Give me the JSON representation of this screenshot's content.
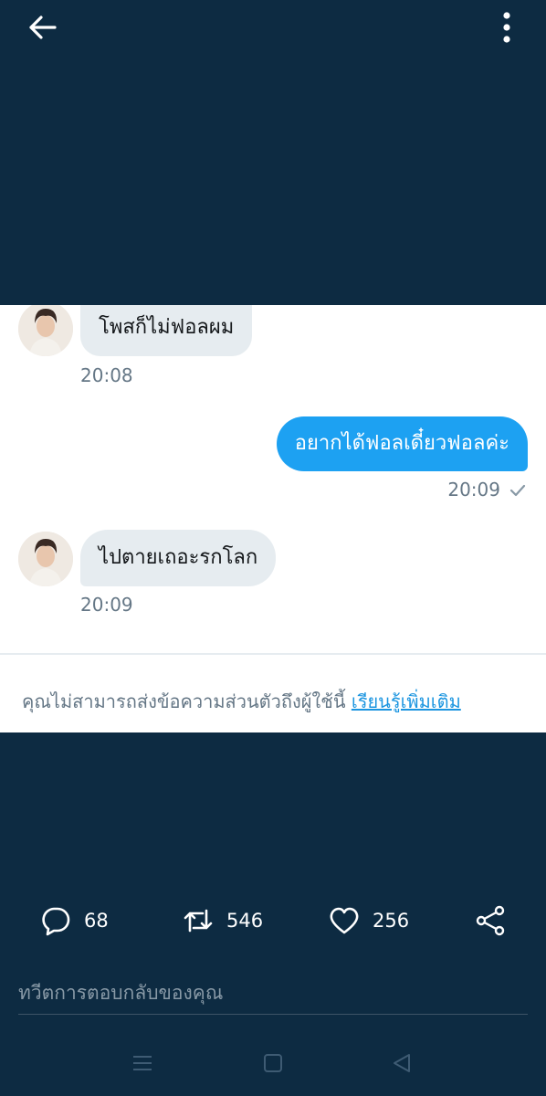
{
  "header": {
    "back_icon": "arrow-left-icon",
    "more_icon": "more-vertical-icon"
  },
  "messages": [
    {
      "side": "in",
      "text": "โพสก็ไม่ฟอลผม",
      "time": "20:08"
    },
    {
      "side": "out",
      "text": "อยากได้ฟอลเดี๋ยวฟอลค่ะ",
      "time": "20:09",
      "status_icon": "check-icon"
    },
    {
      "side": "in",
      "text": "ไปตายเถอะรกโลก",
      "time": "20:09"
    }
  ],
  "notice": {
    "text": "คุณไม่สามารถส่งข้อความส่วนตัวถึงผู้ใช้นี้",
    "link": "เรียนรู้เพิ่มเติม"
  },
  "actions": {
    "replies": {
      "icon": "reply-icon",
      "count": "68"
    },
    "retweets": {
      "icon": "retweet-icon",
      "count": "546"
    },
    "likes": {
      "icon": "heart-icon",
      "count": "256"
    },
    "share": {
      "icon": "share-icon"
    }
  },
  "reply": {
    "placeholder": "ทวีตการตอบกลับของคุณ"
  },
  "colors": {
    "background": "#0d2b42",
    "accent": "#1da1f2",
    "bubble_in": "#e6ecf0",
    "muted": "#657786"
  }
}
